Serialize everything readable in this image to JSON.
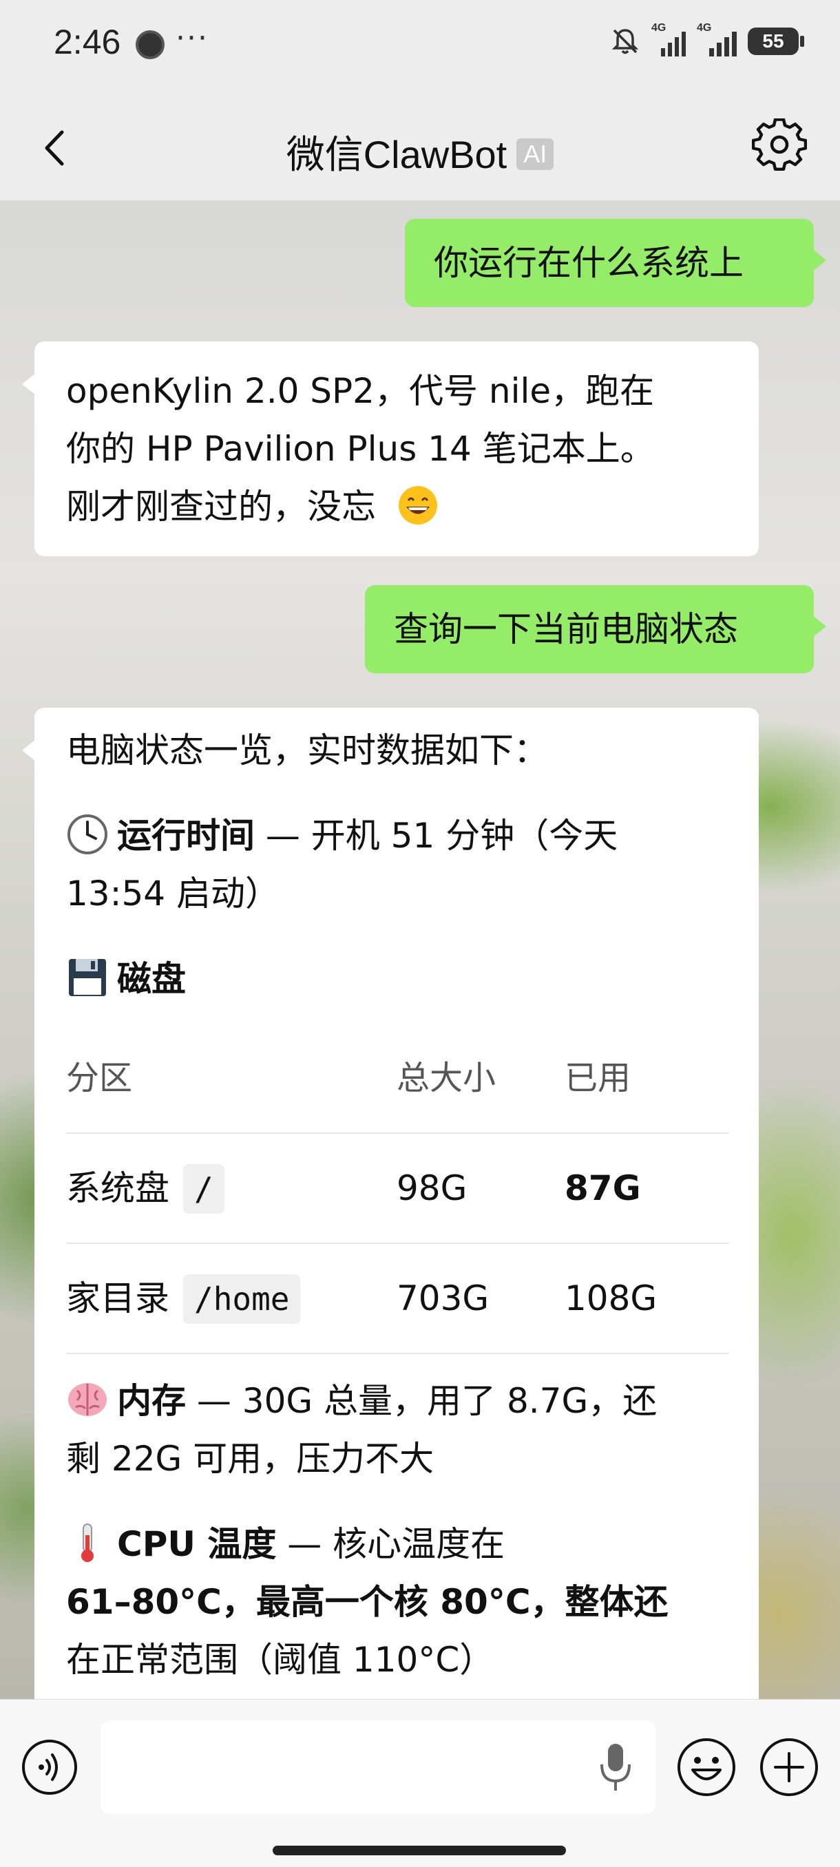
{
  "status_bar": {
    "time": "2:46",
    "more": "···",
    "signal1_label": "4G",
    "signal2_label": "4G",
    "battery": "55"
  },
  "nav": {
    "title": "微信ClawBot",
    "badge": "AI"
  },
  "messages": {
    "m1": "你运行在什么系统上",
    "m2_line1": "openKylin 2.0 SP2，代号 nile，跑在",
    "m2_line2": "你的 HP Pavilion Plus 14 笔记本上。",
    "m2_line3": "刚才刚查过的，没忘",
    "m3": "查询一下当前电脑状态",
    "m4": {
      "intro": "电脑状态一览，实时数据如下：",
      "uptime_label": "运行时间",
      "uptime_line1": " — 开机 51 分钟（今天",
      "uptime_line2": "13:54 启动）",
      "disk_label": "磁盘",
      "table_headers": [
        "分区",
        "总大小",
        "已用"
      ],
      "rows": [
        {
          "name": "系统盘",
          "path": "/",
          "total": "98G",
          "used": "87G"
        },
        {
          "name": "家目录",
          "path": "/home",
          "total": "703G",
          "used": "108G"
        }
      ],
      "mem_label": "内存",
      "mem_line1": " — 30G 总量，用了 8.7G，还",
      "mem_line2": "剩 22G 可用，压力不大",
      "cpu_label": "CPU 温度",
      "cpu_line1": " — 核心温度在",
      "cpu_line2": "61–80°C，最高一个核 80°C，整体还",
      "cpu_line3": "在正常范围（阈值 110°C）"
    }
  },
  "input": {
    "placeholder": ""
  },
  "icons": {
    "emoji_grin": "grinning-face",
    "clock": "clock-icon",
    "floppy": "floppy-disk-icon",
    "brain": "brain-icon",
    "thermometer": "thermometer-icon"
  },
  "colors": {
    "user_bubble": "#95ec69",
    "bot_bubble": "#ffffff"
  }
}
